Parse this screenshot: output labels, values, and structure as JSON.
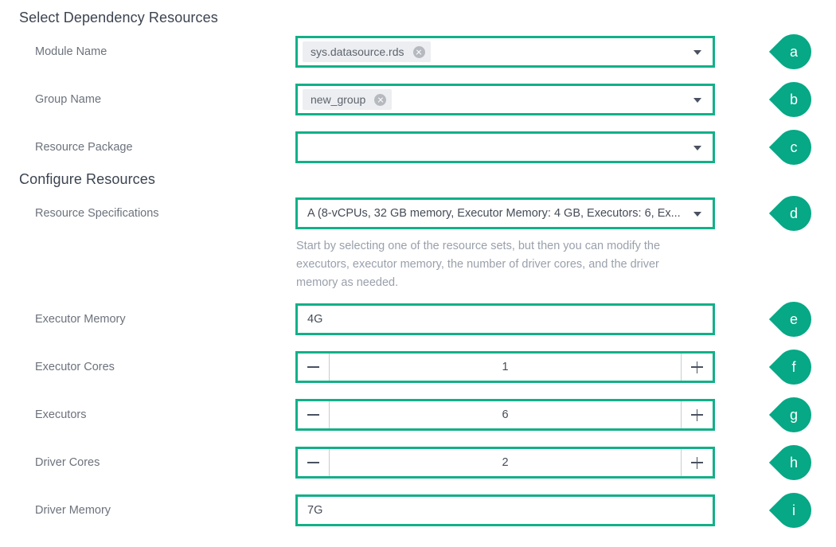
{
  "sections": [
    {
      "title": "Select Dependency Resources"
    },
    {
      "title": "Configure Resources"
    }
  ],
  "fields": {
    "module_name": {
      "label": "Module Name",
      "chip": "sys.datasource.rds",
      "marker": "a"
    },
    "group_name": {
      "label": "Group Name",
      "chip": "new_group",
      "marker": "b"
    },
    "resource_package": {
      "label": "Resource Package",
      "value": "",
      "marker": "c"
    },
    "resource_specifications": {
      "label": "Resource Specifications",
      "value": "A (8-vCPUs, 32 GB memory, Executor Memory: 4 GB, Executors: 6, Ex...",
      "help": "Start by selecting one of the resource sets, but then you can modify the executors, executor memory, the number of driver cores, and the driver memory as needed.",
      "marker": "d"
    },
    "executor_memory": {
      "label": "Executor Memory",
      "value": "4G",
      "marker": "e"
    },
    "executor_cores": {
      "label": "Executor Cores",
      "value": "1",
      "decrement": "minus-icon",
      "increment": "plus-icon",
      "marker": "f"
    },
    "executors": {
      "label": "Executors",
      "value": "6",
      "decrement": "minus-icon",
      "increment": "plus-icon",
      "marker": "g"
    },
    "driver_cores": {
      "label": "Driver Cores",
      "value": "2",
      "decrement": "minus-icon",
      "increment": "plus-icon",
      "marker": "h"
    },
    "driver_memory": {
      "label": "Driver Memory",
      "value": "7G",
      "marker": "i"
    }
  },
  "colors": {
    "accent_green": "#12b088",
    "marker_green": "#06a886",
    "label_gray": "#6c727c",
    "heading_gray": "#3c4450",
    "help_gray": "#9aa0ab",
    "chip_bg": "#eceef1"
  }
}
